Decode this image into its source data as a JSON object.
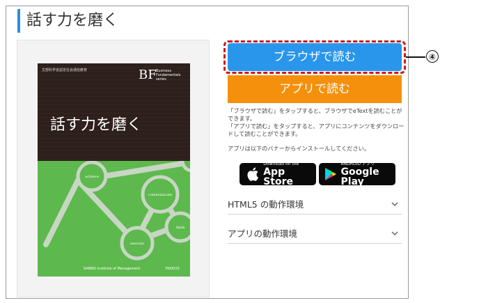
{
  "page": {
    "title": "話す力を磨く"
  },
  "book_cover": {
    "publisher_line": "文部科学省認定社会通信教育",
    "series_logo": "BF",
    "series_name_lines": [
      "Business",
      "Fundamentals",
      "series"
    ],
    "cover_title": "話す力を磨く",
    "circle_labels": [
      "achieve",
      "communicate",
      "think",
      "execute"
    ],
    "footer_left": "SANNO Institute of Management",
    "footer_right": "YW0010"
  },
  "buttons": {
    "read_in_browser": "ブラウザで読む",
    "read_in_app": "アプリで読む"
  },
  "callout": {
    "number": "④",
    "color": "#d0171b"
  },
  "instructions": {
    "browser_line": "「ブラウザで読む」をタップすると、ブラウザでeTextを読むことができます。",
    "app_line": "「アプリで読む」をタップすると、アプリにコンテンツをダウンロードして読むことができます。",
    "install_line": "アプリは以下のバナーからインストールしてください。"
  },
  "store_badges": {
    "apple": {
      "small": "Download on the",
      "big": "App Store"
    },
    "google": {
      "small": "ANDROID アプリ",
      "big": "Google Play"
    }
  },
  "accordions": [
    {
      "label": "HTML5 の動作環境"
    },
    {
      "label": "アプリの動作環境"
    }
  ],
  "colors": {
    "accent_blue": "#2996ec",
    "accent_orange": "#f5900d",
    "title_bar": "#2a8ee0",
    "cover_green": "#5db94d"
  }
}
